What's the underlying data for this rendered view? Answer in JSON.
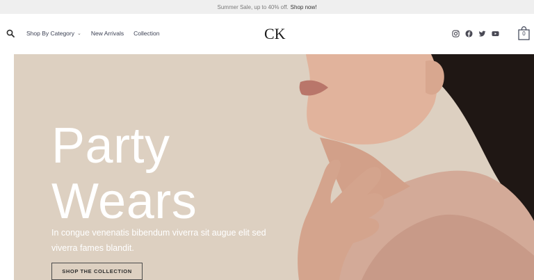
{
  "announcement": {
    "text": "Summer Sale, up to 40% off.",
    "link": "Shop now!"
  },
  "header": {
    "search_icon": "search-icon",
    "nav": [
      {
        "label": "Shop By Category",
        "has_dropdown": true
      },
      {
        "label": "New Arrivals",
        "has_dropdown": false
      },
      {
        "label": "Collection",
        "has_dropdown": false
      }
    ],
    "logo": "CK",
    "social": [
      "instagram-icon",
      "facebook-icon",
      "twitter-icon",
      "youtube-icon"
    ],
    "cart_count": "0"
  },
  "hero": {
    "title_line1": "Party",
    "title_line2": "Wears",
    "subtitle": "In congue venenatis bibendum viverra sit augue elit sed viverra fames blandit.",
    "button": "SHOP THE COLLECTION",
    "background_color": "#ddd0c1"
  }
}
